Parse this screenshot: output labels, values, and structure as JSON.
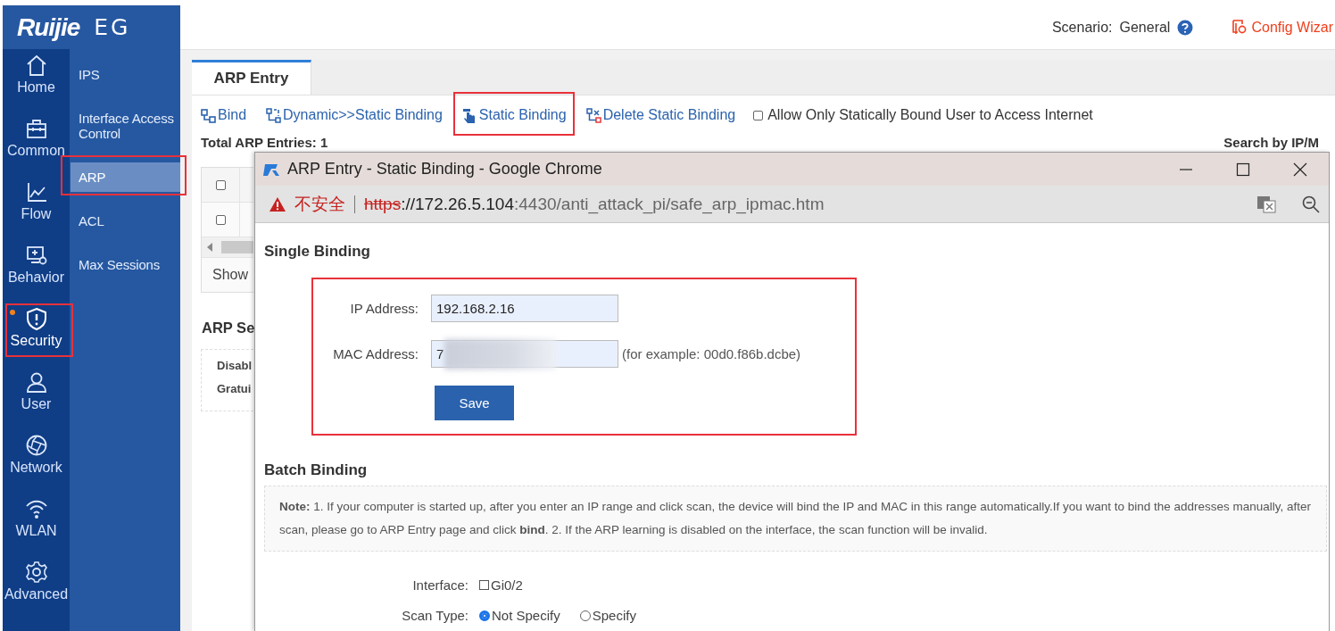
{
  "brand": {
    "logo": "Ruijie",
    "product": "EG"
  },
  "header": {
    "scenario_label": "Scenario:",
    "scenario_value": "General",
    "config_wizard": "Config Wizar"
  },
  "rail": [
    {
      "label": "Home",
      "highlighted": false,
      "notify": false
    },
    {
      "label": "Common",
      "highlighted": false,
      "notify": false
    },
    {
      "label": "Flow",
      "highlighted": false,
      "notify": false
    },
    {
      "label": "Behavior",
      "highlighted": false,
      "notify": false
    },
    {
      "label": "Security",
      "highlighted": true,
      "notify": true
    },
    {
      "label": "User",
      "highlighted": false,
      "notify": false
    },
    {
      "label": "Network",
      "highlighted": false,
      "notify": false
    },
    {
      "label": "WLAN",
      "highlighted": false,
      "notify": false
    },
    {
      "label": "Advanced",
      "highlighted": false,
      "notify": false
    }
  ],
  "submenu": [
    {
      "label": "IPS",
      "selected": false,
      "highlighted": false
    },
    {
      "label": "Interface Access Control",
      "selected": false,
      "highlighted": false
    },
    {
      "label": "ARP",
      "selected": true,
      "highlighted": true
    },
    {
      "label": "ACL",
      "selected": false,
      "highlighted": false
    },
    {
      "label": "Max Sessions",
      "selected": false,
      "highlighted": false
    }
  ],
  "tabs": [
    {
      "label": "ARP Entry",
      "selected": true
    }
  ],
  "toolbar": {
    "actions": [
      {
        "label": "Bind",
        "highlighted": false
      },
      {
        "label": "Dynamic>>Static Binding",
        "highlighted": false
      },
      {
        "label": "Static Binding",
        "highlighted": true
      },
      {
        "label": "Delete Static Binding",
        "highlighted": false
      }
    ],
    "allow_static_only": {
      "label": "Allow Only Statically Bound User to Access Internet",
      "checked": false
    }
  },
  "total_entries": "Total ARP Entries: 1",
  "search_label": "Search by IP/M",
  "table": {
    "header_checked": false,
    "rows": [
      {
        "checked": false
      }
    ]
  },
  "pager_text": "Show",
  "settings": {
    "title": "ARP Se",
    "lines": [
      "Disabl",
      "Gratui"
    ]
  },
  "popup": {
    "title": "ARP Entry - Static Binding - Google Chrome",
    "security_warning": "不安全",
    "url": {
      "scheme": "https",
      "host": "://172.26.5.104",
      "path": ":4430/anti_attack_pi/safe_arp_ipmac.htm"
    },
    "single": {
      "title": "Single Binding",
      "highlighted": true,
      "fields": [
        {
          "label": "IP Address:",
          "value": "192.168.2.16",
          "redacted": false
        },
        {
          "label": "MAC Address:",
          "value": "7",
          "hint": "(for example: 00d0.f86b.dcbe)",
          "redacted": true
        }
      ],
      "save": "Save"
    },
    "batch": {
      "title": "Batch Binding",
      "note": "**Note:** 1. If your computer is started up, after you enter an IP range and click scan, the device will bind the IP and MAC in this range automatically.If you want to bind the addresses manually, after scan, please go to ARP Entry page and click **bind**. 2. If the ARP learning is disabled on the interface, the scan function will be invalid.",
      "interface": {
        "label": "Interface:",
        "options": [
          {
            "label": "Gi0/2",
            "checked": false
          }
        ]
      },
      "scan_type": {
        "label": "Scan Type:",
        "options": [
          {
            "label": "Not Specify",
            "selected": true
          },
          {
            "label": "Specify",
            "selected": false
          }
        ]
      }
    }
  }
}
